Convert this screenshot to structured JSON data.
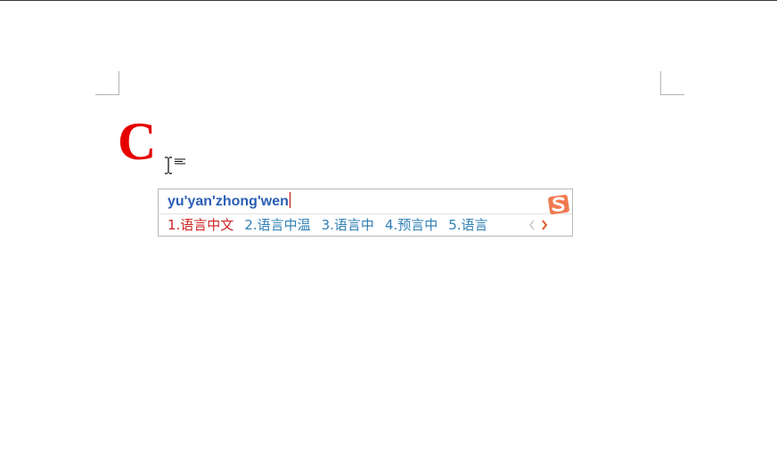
{
  "document": {
    "letter": "C"
  },
  "ime": {
    "input": "yu'yan'zhong'wen",
    "candidates": [
      "1.语言中文",
      "2.语言中温",
      "3.语言中",
      "4.预言中",
      "5.语言"
    ],
    "prev_icon": "chevron-left-icon",
    "next_icon": "chevron-right-icon",
    "logo_icon": "sogou-logo-icon"
  },
  "colors": {
    "letter": "#e60000",
    "pinyin": "#2b5fb5",
    "first_candidate": "#cc2222",
    "candidate": "#2e7fb4",
    "logo": "#f07a50"
  }
}
